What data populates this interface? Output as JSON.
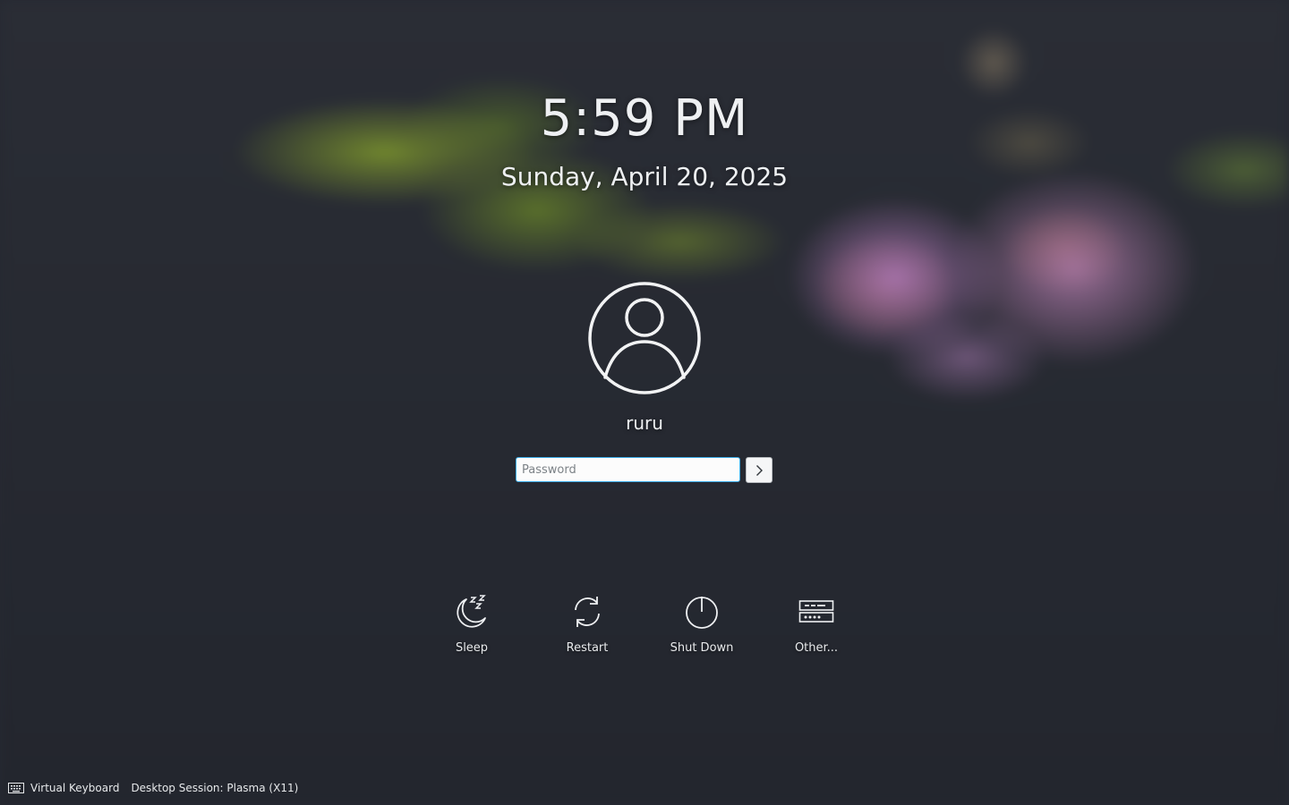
{
  "lock": {
    "time": "5:59 PM",
    "date": "Sunday, April 20, 2025"
  },
  "user": {
    "name": "ruru",
    "avatar_icon": "user-avatar-icon"
  },
  "login": {
    "password_placeholder": "Password",
    "password_value": "",
    "submit_icon": "chevron-right-icon"
  },
  "actions": [
    {
      "label": "Sleep",
      "icon": "sleep-icon"
    },
    {
      "label": "Restart",
      "icon": "restart-icon"
    },
    {
      "label": "Shut Down",
      "icon": "power-icon"
    },
    {
      "label": "Other...",
      "icon": "other-icon"
    }
  ],
  "footer": {
    "virtual_keyboard_label": "Virtual Keyboard",
    "session_label": "Desktop Session: Plasma (X11)",
    "keyboard_icon": "keyboard-icon"
  },
  "colors": {
    "accent": "#3daee9",
    "background": "#262932",
    "text": "#eef0f2"
  }
}
